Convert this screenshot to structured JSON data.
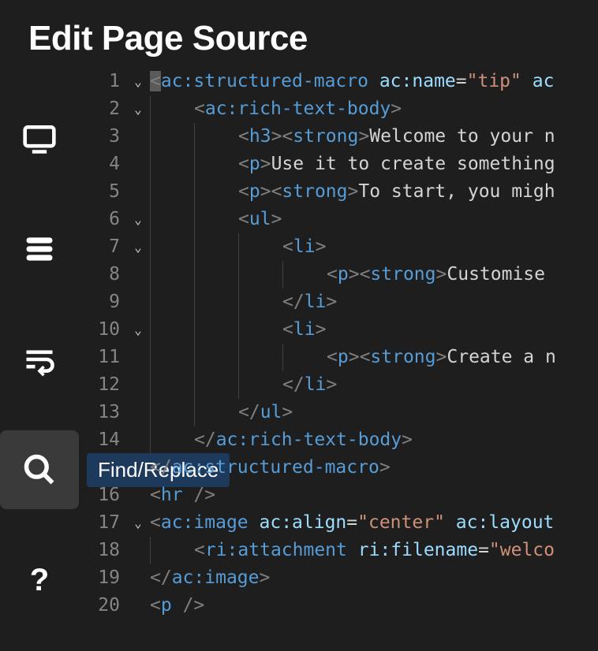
{
  "header": {
    "title": "Edit Page Source"
  },
  "sidebar": {
    "tooltip": "Find/Replace",
    "items": [
      {
        "name": "preview",
        "icon": "monitor-icon"
      },
      {
        "name": "database",
        "icon": "stack-icon"
      },
      {
        "name": "wrap",
        "icon": "wrap-icon"
      },
      {
        "name": "search",
        "icon": "search-icon",
        "active": true,
        "tooltip": true
      },
      {
        "name": "help",
        "icon": "help-icon"
      }
    ]
  },
  "editor": {
    "lines": [
      {
        "n": "1",
        "fold": "v",
        "indent": 0,
        "tokens": [
          [
            "cursor",
            "<"
          ],
          [
            "tag",
            "ac:structured-macro"
          ],
          [
            "text",
            " "
          ],
          [
            "attr",
            "ac:name"
          ],
          [
            "op",
            "="
          ],
          [
            "str",
            "\"tip\""
          ],
          [
            "text",
            " "
          ],
          [
            "attr",
            "ac"
          ]
        ]
      },
      {
        "n": "2",
        "fold": "v",
        "indent": 1,
        "tokens": [
          [
            "punc",
            "<"
          ],
          [
            "tag",
            "ac:rich-text-body"
          ],
          [
            "punc",
            ">"
          ]
        ]
      },
      {
        "n": "3",
        "fold": "",
        "indent": 2,
        "tokens": [
          [
            "punc",
            "<"
          ],
          [
            "tag",
            "h3"
          ],
          [
            "punc",
            "><"
          ],
          [
            "tag",
            "strong"
          ],
          [
            "punc",
            ">"
          ],
          [
            "text",
            "Welcome to your n"
          ]
        ]
      },
      {
        "n": "4",
        "fold": "",
        "indent": 2,
        "tokens": [
          [
            "punc",
            "<"
          ],
          [
            "tag",
            "p"
          ],
          [
            "punc",
            ">"
          ],
          [
            "text",
            "Use it to create something"
          ]
        ]
      },
      {
        "n": "5",
        "fold": "",
        "indent": 2,
        "tokens": [
          [
            "punc",
            "<"
          ],
          [
            "tag",
            "p"
          ],
          [
            "punc",
            "><"
          ],
          [
            "tag",
            "strong"
          ],
          [
            "punc",
            ">"
          ],
          [
            "text",
            "To start, you migh"
          ]
        ]
      },
      {
        "n": "6",
        "fold": "v",
        "indent": 2,
        "tokens": [
          [
            "punc",
            "<"
          ],
          [
            "tag",
            "ul"
          ],
          [
            "punc",
            ">"
          ]
        ]
      },
      {
        "n": "7",
        "fold": "v",
        "indent": 3,
        "tokens": [
          [
            "punc",
            "<"
          ],
          [
            "tag",
            "li"
          ],
          [
            "punc",
            ">"
          ]
        ]
      },
      {
        "n": "8",
        "fold": "",
        "indent": 4,
        "tokens": [
          [
            "punc",
            "<"
          ],
          [
            "tag",
            "p"
          ],
          [
            "punc",
            "><"
          ],
          [
            "tag",
            "strong"
          ],
          [
            "punc",
            ">"
          ],
          [
            "text",
            "Customise "
          ]
        ]
      },
      {
        "n": "9",
        "fold": "",
        "indent": 3,
        "tokens": [
          [
            "punc",
            "</"
          ],
          [
            "tag",
            "li"
          ],
          [
            "punc",
            ">"
          ]
        ]
      },
      {
        "n": "10",
        "fold": "v",
        "indent": 3,
        "tokens": [
          [
            "punc",
            "<"
          ],
          [
            "tag",
            "li"
          ],
          [
            "punc",
            ">"
          ]
        ]
      },
      {
        "n": "11",
        "fold": "",
        "indent": 4,
        "tokens": [
          [
            "punc",
            "<"
          ],
          [
            "tag",
            "p"
          ],
          [
            "punc",
            "><"
          ],
          [
            "tag",
            "strong"
          ],
          [
            "punc",
            ">"
          ],
          [
            "text",
            "Create a n"
          ]
        ]
      },
      {
        "n": "12",
        "fold": "",
        "indent": 3,
        "tokens": [
          [
            "punc",
            "</"
          ],
          [
            "tag",
            "li"
          ],
          [
            "punc",
            ">"
          ]
        ]
      },
      {
        "n": "13",
        "fold": "",
        "indent": 2,
        "tokens": [
          [
            "punc",
            "</"
          ],
          [
            "tag",
            "ul"
          ],
          [
            "punc",
            ">"
          ]
        ]
      },
      {
        "n": "14",
        "fold": "",
        "indent": 1,
        "tokens": [
          [
            "punc",
            "</"
          ],
          [
            "tag",
            "ac:rich-text-body"
          ],
          [
            "punc",
            ">"
          ]
        ]
      },
      {
        "n": "15",
        "fold": "",
        "indent": 0,
        "tokens": [
          [
            "punc",
            "</"
          ],
          [
            "tag",
            "ac:structured-macro"
          ],
          [
            "punc",
            ">"
          ]
        ]
      },
      {
        "n": "16",
        "fold": "",
        "indent": 0,
        "tokens": [
          [
            "punc",
            "<"
          ],
          [
            "tag",
            "hr"
          ],
          [
            "text",
            " "
          ],
          [
            "punc",
            "/>"
          ]
        ]
      },
      {
        "n": "17",
        "fold": "v",
        "indent": 0,
        "tokens": [
          [
            "punc",
            "<"
          ],
          [
            "tag",
            "ac:image"
          ],
          [
            "text",
            " "
          ],
          [
            "attr",
            "ac:align"
          ],
          [
            "op",
            "="
          ],
          [
            "str",
            "\"center\""
          ],
          [
            "text",
            " "
          ],
          [
            "attr",
            "ac:layout"
          ]
        ]
      },
      {
        "n": "18",
        "fold": "",
        "indent": 1,
        "tokens": [
          [
            "punc",
            "<"
          ],
          [
            "tag",
            "ri:attachment"
          ],
          [
            "text",
            " "
          ],
          [
            "attr",
            "ri:filename"
          ],
          [
            "op",
            "="
          ],
          [
            "str",
            "\"welco"
          ]
        ]
      },
      {
        "n": "19",
        "fold": "",
        "indent": 0,
        "tokens": [
          [
            "punc",
            "</"
          ],
          [
            "tag",
            "ac:image"
          ],
          [
            "punc",
            ">"
          ]
        ]
      },
      {
        "n": "20",
        "fold": "",
        "indent": 0,
        "tokens": [
          [
            "punc",
            "<"
          ],
          [
            "tag",
            "p"
          ],
          [
            "text",
            " "
          ],
          [
            "punc",
            "/>"
          ]
        ]
      }
    ]
  }
}
